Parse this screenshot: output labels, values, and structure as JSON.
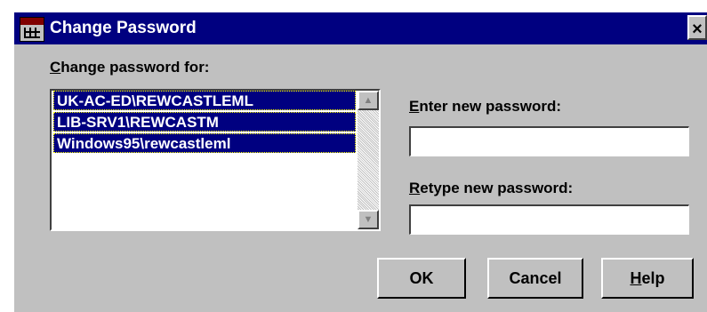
{
  "window": {
    "title": "Change Password",
    "close_glyph": "×"
  },
  "labels": {
    "change_for_first": "C",
    "change_for_rest": "hange password for:",
    "new_pw_first": "E",
    "new_pw_rest": "nter new password:",
    "retype_first": "R",
    "retype_rest": "etype new password:"
  },
  "accounts": [
    "UK-AC-ED\\REWCASTLEML",
    "LIB-SRV1\\REWCASTM",
    "Windows95\\rewcastleml"
  ],
  "fields": {
    "new_password": "",
    "retype_password": ""
  },
  "buttons": {
    "ok": "OK",
    "cancel": "Cancel",
    "help_first": "H",
    "help_rest": "elp"
  },
  "icons": {
    "app": "password-app-icon",
    "close": "close-icon",
    "scroll_up": "arrow-up-icon",
    "scroll_down": "arrow-down-icon"
  },
  "colors": {
    "titlebar": "#000080",
    "dialog_bg": "#c0c0c0",
    "selection": "#000080"
  }
}
